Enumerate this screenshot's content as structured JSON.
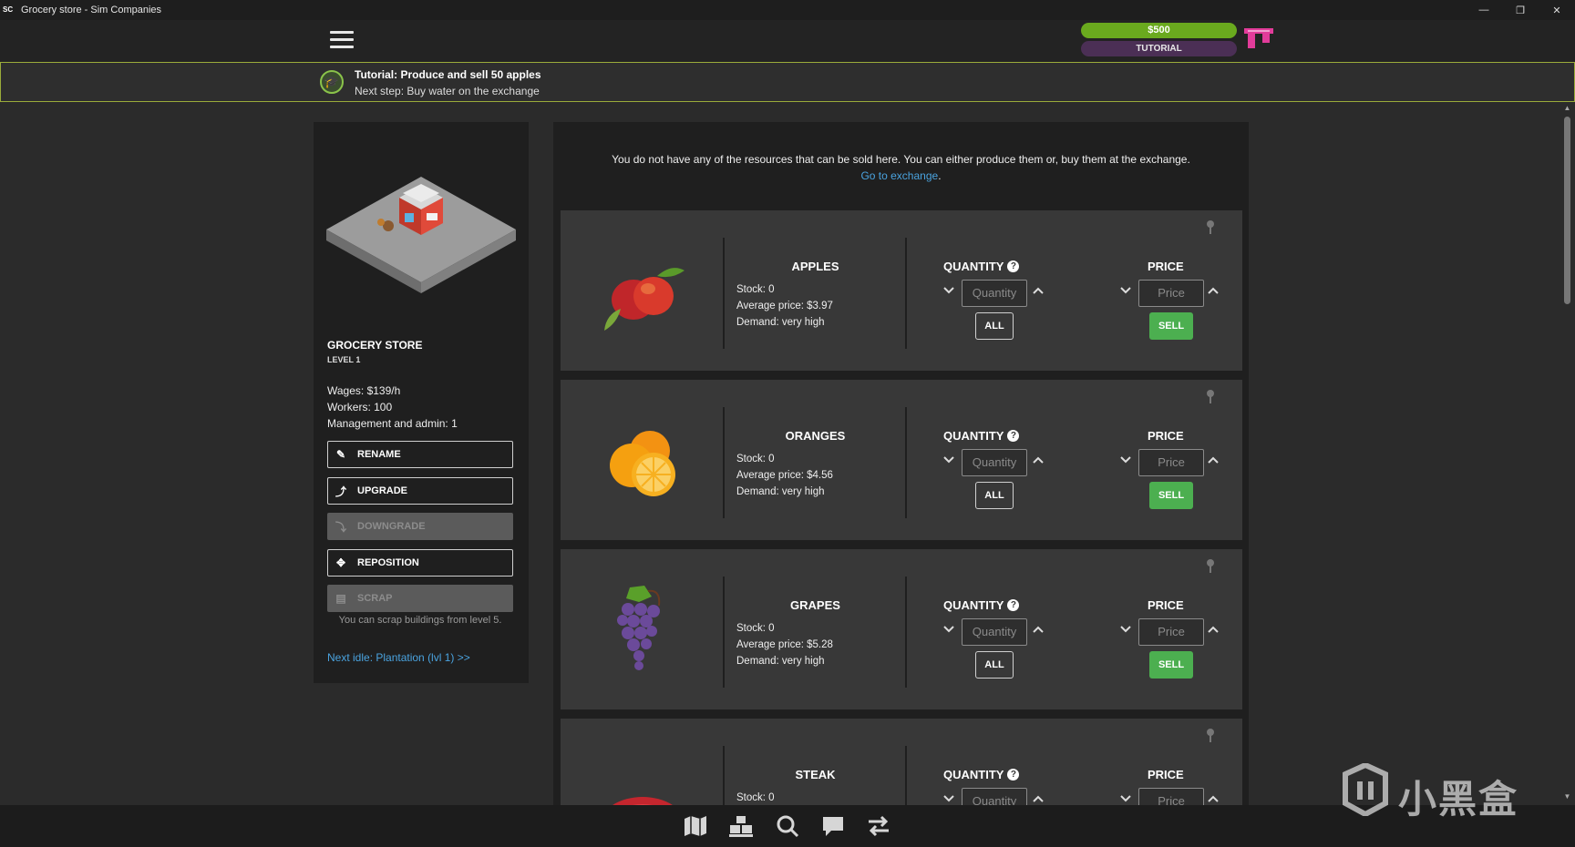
{
  "window": {
    "app_badge": "SC",
    "title": "Grocery store - Sim Companies",
    "controls": [
      "minimize",
      "restore",
      "close"
    ]
  },
  "header": {
    "money": "$500",
    "mode": "TUTORIAL",
    "menu_icon": "hamburger-icon"
  },
  "tutorial": {
    "title": "Tutorial: Produce and sell 50 apples",
    "next_step": "Next step: Buy water on the exchange"
  },
  "building": {
    "name": "GROCERY STORE",
    "level": "LEVEL 1",
    "wages": "Wages: $139/h",
    "workers": "Workers: 100",
    "management": "Management and admin: 1",
    "buttons": {
      "rename": "RENAME",
      "upgrade": "UPGRADE",
      "downgrade": "DOWNGRADE",
      "reposition": "REPOSITION",
      "scrap": "SCRAP"
    },
    "scrap_note": "You can scrap buildings from level 5.",
    "next_idle": "Next idle: Plantation (lvl 1) >>"
  },
  "main": {
    "notice": "You do not have any of the resources that can be sold here. You can either produce them or, buy them at the exchange.",
    "exchange_link": "Go to exchange",
    "quantity_label": "QUANTITY",
    "price_label": "PRICE",
    "quantity_placeholder": "Quantity",
    "price_placeholder": "Price",
    "all_label": "ALL",
    "sell_label": "SELL",
    "products": [
      {
        "name": "APPLES",
        "stock": "Stock: 0",
        "avg_price": "Average price: $3.97",
        "demand": "Demand: very high"
      },
      {
        "name": "ORANGES",
        "stock": "Stock: 0",
        "avg_price": "Average price: $4.56",
        "demand": "Demand: very high"
      },
      {
        "name": "GRAPES",
        "stock": "Stock: 0",
        "avg_price": "Average price: $5.28",
        "demand": "Demand: very high"
      },
      {
        "name": "STEAK",
        "stock": "Stock: 0"
      }
    ]
  },
  "bottom_nav": [
    "map-icon",
    "warehouse-icon",
    "search-icon",
    "chat-icon",
    "exchange-icon"
  ],
  "watermark": "小黑盒",
  "colors": {
    "accent_green": "#4caf50",
    "money_green": "#6aaa1e",
    "tutorial_purple": "#4b2f55",
    "link_blue": "#4aa3df",
    "banner_border": "#9aab3a"
  }
}
